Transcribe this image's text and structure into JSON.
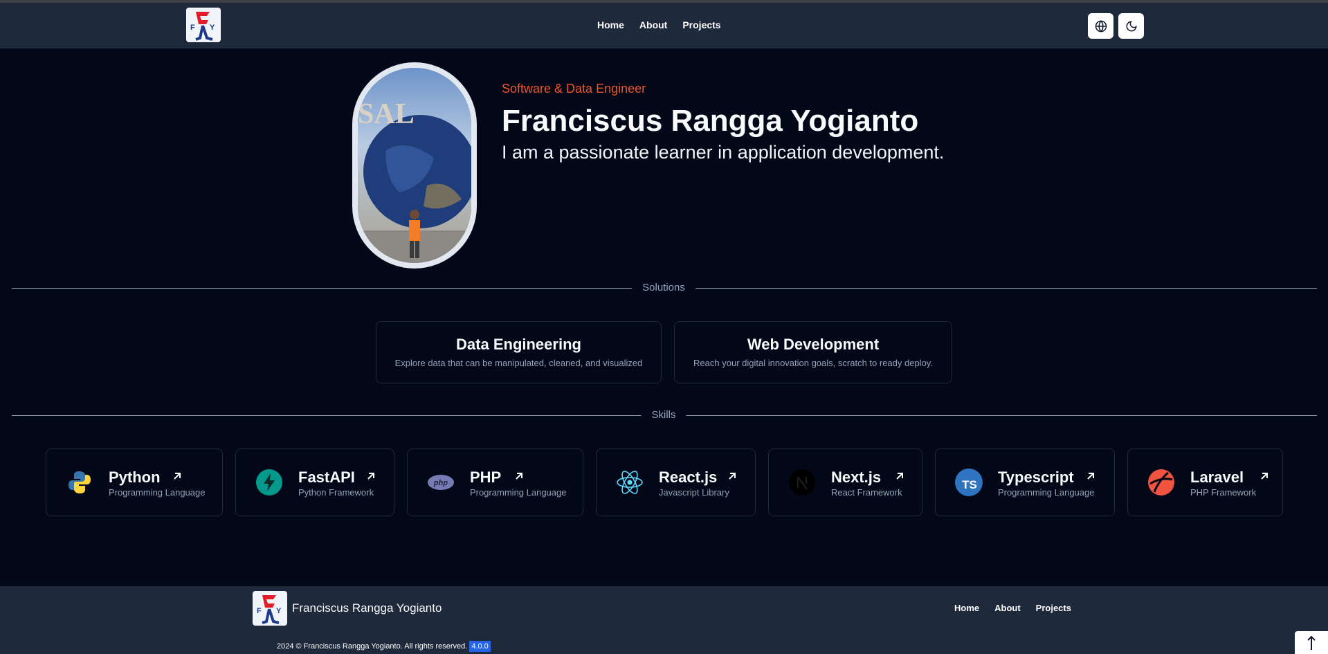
{
  "nav": {
    "logo_alt": "FRY",
    "links": [
      "Home",
      "About",
      "Projects"
    ],
    "language_icon": "globe-icon",
    "theme_icon": "moon-icon"
  },
  "hero": {
    "role": "Software & Data Engineer",
    "name": "Franciscus Rangga Yogianto",
    "tagline": "I am a passionate learner in application development."
  },
  "solutions": {
    "label": "Solutions",
    "items": [
      {
        "title": "Data Engineering",
        "description": "Explore data that can be manipulated, cleaned, and visualized"
      },
      {
        "title": "Web Development",
        "description": "Reach your digital innovation goals, scratch to ready deploy."
      }
    ]
  },
  "skills": {
    "label": "Skills",
    "items": [
      {
        "title": "Python",
        "subtitle": "Programming Language",
        "icon": "python-icon"
      },
      {
        "title": "FastAPI",
        "subtitle": "Python Framework",
        "icon": "fastapi-icon"
      },
      {
        "title": "PHP",
        "subtitle": "Programming Language",
        "icon": "php-icon"
      },
      {
        "title": "React.js",
        "subtitle": "Javascript Library",
        "icon": "react-icon"
      },
      {
        "title": "Next.js",
        "subtitle": "React Framework",
        "icon": "nextjs-icon"
      },
      {
        "title": "Typescript",
        "subtitle": "Programming Language",
        "icon": "typescript-icon"
      },
      {
        "title": "Laravel",
        "subtitle": "PHP Framework",
        "icon": "laravel-icon"
      }
    ]
  },
  "footer": {
    "name": "Franciscus Rangga Yogianto",
    "links": [
      "Home",
      "About",
      "Projects"
    ],
    "copyright": "2024 © Franciscus Rangga Yogianto. All rights reserved.",
    "version": "4.0.0"
  },
  "colors": {
    "background": "#020817",
    "navbar": "#1e293b",
    "accent": "#f0542c",
    "muted": "#94a3b8"
  }
}
